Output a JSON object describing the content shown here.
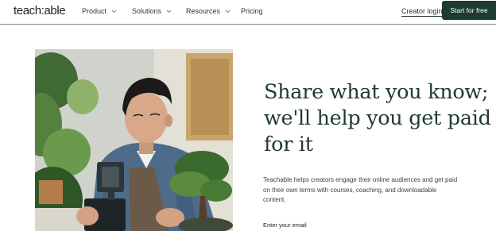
{
  "header": {
    "logo_text": "teach:able",
    "nav": [
      {
        "label": "Product",
        "has_dropdown": true
      },
      {
        "label": "Solutions",
        "has_dropdown": true
      },
      {
        "label": "Resources",
        "has_dropdown": true
      },
      {
        "label": "Pricing",
        "has_dropdown": false
      }
    ],
    "creator_login": "Creator login",
    "cta_label": "Start for free"
  },
  "hero": {
    "headline": "Share what you know; we'll help you get paid for it",
    "subtext": "Teachable helps creators engage their online audiences and get paid on their own terms with courses, coaching, and downloadable content.",
    "email_label": "Enter your email"
  },
  "colors": {
    "brand_dark_green": "#1d3a33",
    "headline_green": "#1f3a33",
    "header_divider": "#7c8584"
  },
  "icons": {
    "nav_dropdown": "chevron-down-icon"
  }
}
